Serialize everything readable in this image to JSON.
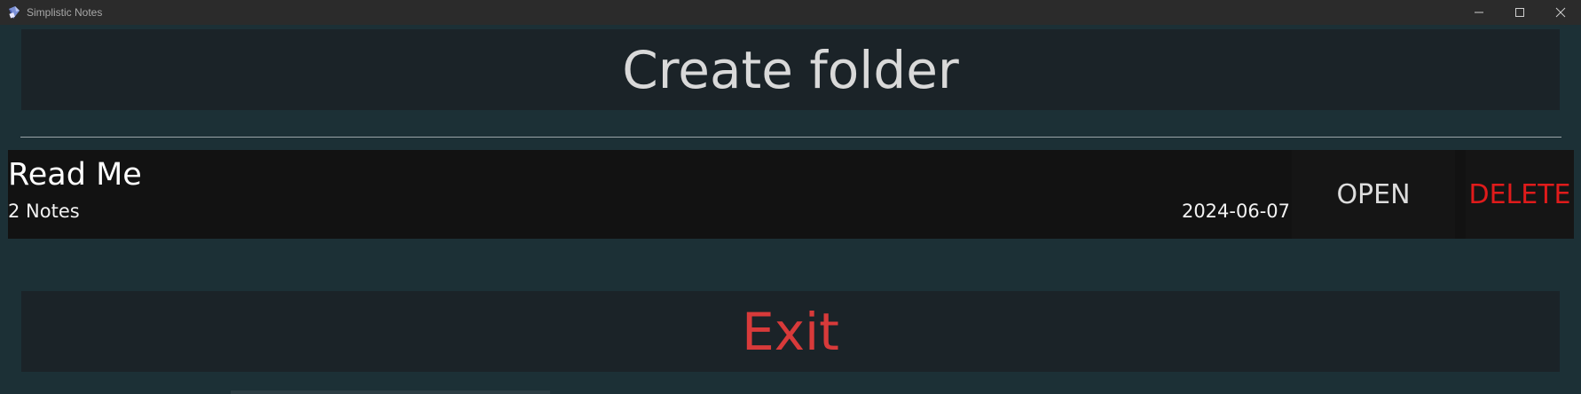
{
  "window": {
    "title": "Simplistic Notes",
    "controls": {
      "minimize_icon": "minimize-icon",
      "maximize_icon": "maximize-icon",
      "close_icon": "close-icon"
    }
  },
  "actions": {
    "create_label": "Create folder",
    "exit_label": "Exit"
  },
  "folders": [
    {
      "name": "Read Me",
      "count": "2 Notes",
      "date": "2024-06-07",
      "open_label": "OPEN",
      "delete_label": "DELETE"
    }
  ],
  "colors": {
    "background": "#1c3036",
    "panel": "#1b2328",
    "row": "#121212",
    "exit_text": "#d83a3a",
    "delete_text": "#e01b1b"
  }
}
